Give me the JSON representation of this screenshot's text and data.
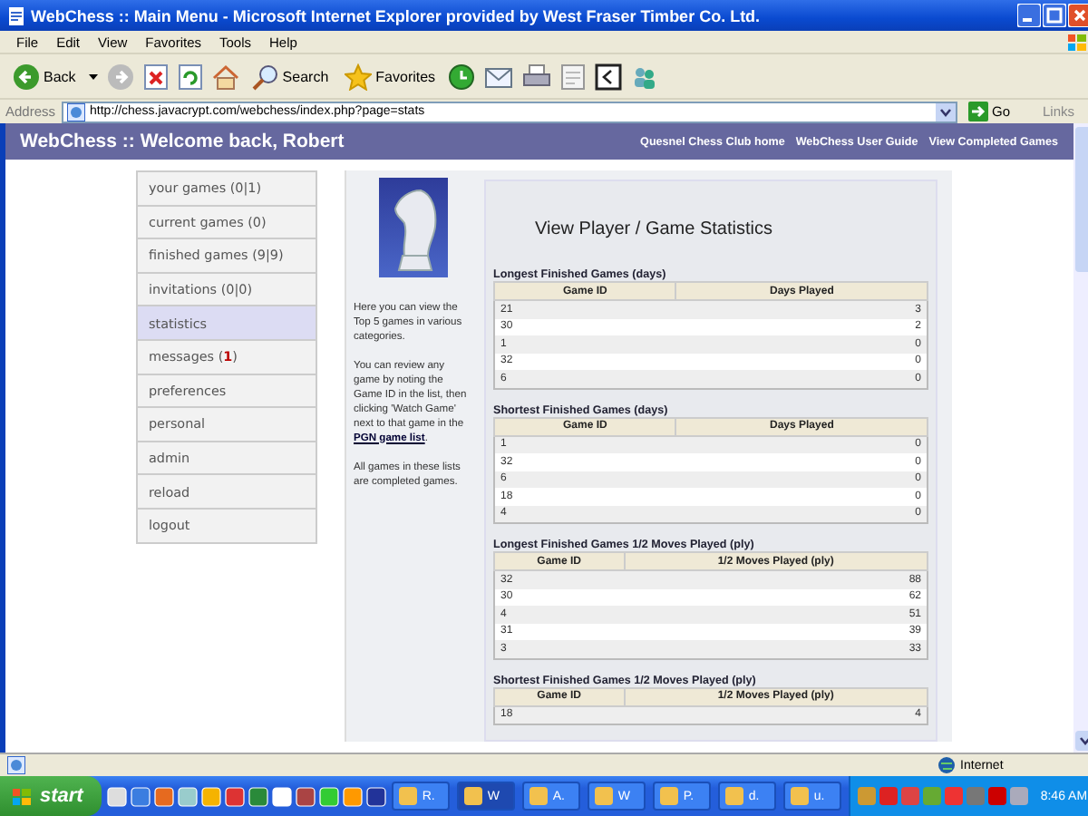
{
  "window": {
    "title": "WebChess :: Main Menu - Microsoft Internet Explorer provided by West Fraser Timber Co. Ltd."
  },
  "menu": [
    "File",
    "Edit",
    "View",
    "Favorites",
    "Tools",
    "Help"
  ],
  "toolbar": {
    "back": "Back",
    "search": "Search",
    "favorites": "Favorites"
  },
  "address": {
    "label": "Address",
    "url": "http://chess.javacrypt.com/webchess/index.php?page=stats",
    "go": "Go",
    "links": "Links"
  },
  "header": {
    "title": "WebChess :: Welcome back, Robert",
    "links": [
      "Quesnel Chess Club home",
      "WebChess User Guide",
      "View Completed Games"
    ]
  },
  "sidebar": {
    "items": [
      {
        "label": "your games (0|1)",
        "selected": false
      },
      {
        "label": "current games (0)",
        "selected": false
      },
      {
        "label": "finished games (9|9)",
        "selected": false
      },
      {
        "label": "invitations (0|0)",
        "selected": false
      },
      {
        "label": "statistics",
        "selected": true
      },
      {
        "label": "messages (**1**)",
        "selected": false
      },
      {
        "label": "preferences",
        "selected": false
      },
      {
        "label": "personal",
        "selected": false
      },
      {
        "label": "admin",
        "selected": false
      },
      {
        "label": "reload",
        "selected": false
      },
      {
        "label": "logout",
        "selected": false
      }
    ]
  },
  "info": {
    "intro": "Here you can view the Top 5 games in various categories.",
    "review_before": "You can review any game by noting the Game ID in the list, then clicking 'Watch Game' next to that game in the ",
    "review_link": "PGN game list",
    "review_after": ".",
    "note": "All games in these lists are completed games."
  },
  "stats": {
    "heading": "View Player / Game Statistics",
    "tables": [
      {
        "title": "Longest Finished Games (days)",
        "columns": [
          "Game ID",
          "Days Played"
        ],
        "rows": [
          [
            "21",
            "3"
          ],
          [
            "30",
            "2"
          ],
          [
            "1",
            "0"
          ],
          [
            "32",
            "0"
          ],
          [
            "6",
            "0"
          ]
        ]
      },
      {
        "title": "Shortest Finished Games (days)",
        "columns": [
          "Game ID",
          "Days Played"
        ],
        "rows": [
          [
            "1",
            "0"
          ],
          [
            "32",
            "0"
          ],
          [
            "6",
            "0"
          ],
          [
            "18",
            "0"
          ],
          [
            "4",
            "0"
          ]
        ]
      },
      {
        "title": "Longest Finished Games 1/2 Moves Played (ply)",
        "columns": [
          "Game ID",
          "1/2 Moves Played (ply)"
        ],
        "rows": [
          [
            "32",
            "88"
          ],
          [
            "30",
            "62"
          ],
          [
            "4",
            "51"
          ],
          [
            "31",
            "39"
          ],
          [
            "3",
            "33"
          ]
        ]
      },
      {
        "title": "Shortest Finished Games 1/2 Moves Played (ply)",
        "columns": [
          "Game ID",
          "1/2 Moves Played (ply)"
        ],
        "rows": [
          [
            "18",
            "4"
          ]
        ]
      }
    ]
  },
  "status_bar": {
    "zone": "Internet"
  },
  "taskbar": {
    "start": "start",
    "tasks": [
      {
        "label": "R.",
        "selected": false
      },
      {
        "label": "W",
        "selected": true
      },
      {
        "label": "A.",
        "selected": false
      },
      {
        "label": "W",
        "selected": false
      },
      {
        "label": "P.",
        "selected": false
      },
      {
        "label": "d.",
        "selected": false
      },
      {
        "label": "u.",
        "selected": false
      }
    ],
    "clock": "8:46 AM"
  }
}
